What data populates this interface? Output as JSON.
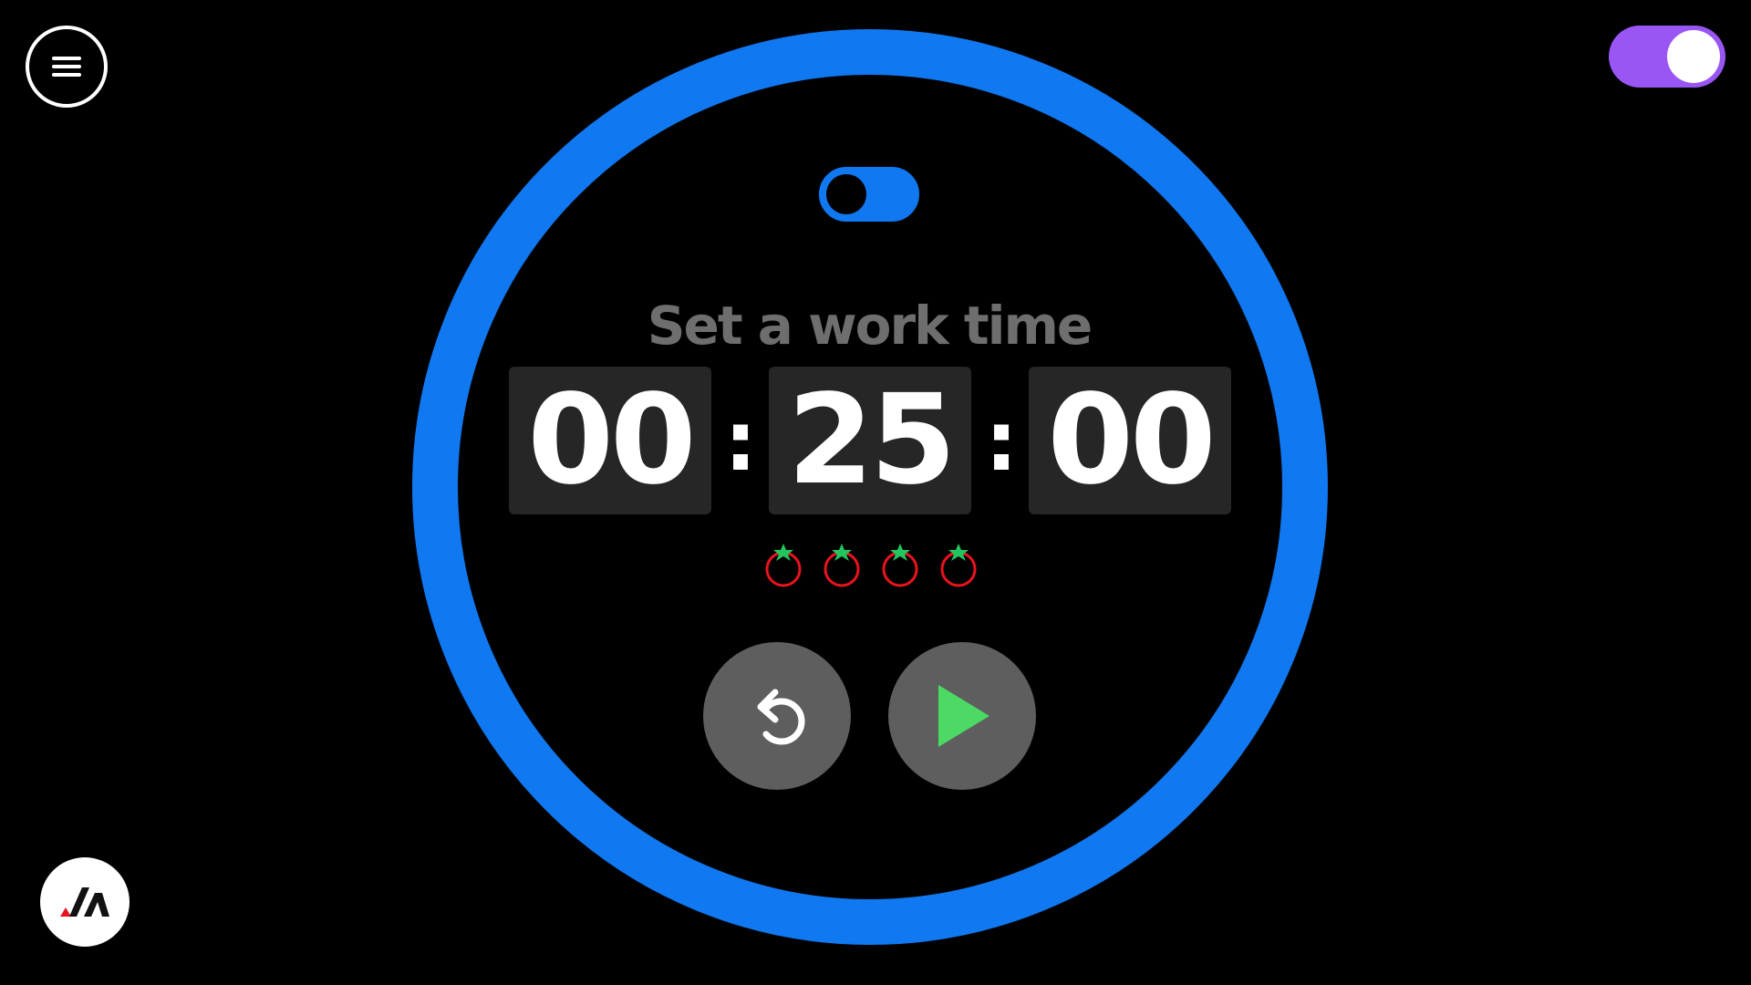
{
  "app": {
    "status_title": "Set a work time",
    "colors": {
      "background": "#000000",
      "ring": "#1078f0",
      "title": "#6e6e6e",
      "theme_toggle": "#9a55f5",
      "mode_toggle": "#1078f0",
      "tomato_body": "#e8141e",
      "tomato_leaf": "#22c55e",
      "play": "#4cd964"
    }
  },
  "header": {
    "menu_icon": "hamburger-menu-icon",
    "theme_toggle_state": "on"
  },
  "timer": {
    "mode_toggle_state": "off",
    "hours": "00",
    "minutes": "25",
    "seconds": "00",
    "separator": ":",
    "sessions_count": 4,
    "session_icon": "tomato-icon"
  },
  "controls": {
    "reset_icon": "reset-icon",
    "play_icon": "play-icon"
  },
  "footer": {
    "logo_icon": "brand-logo-icon"
  }
}
